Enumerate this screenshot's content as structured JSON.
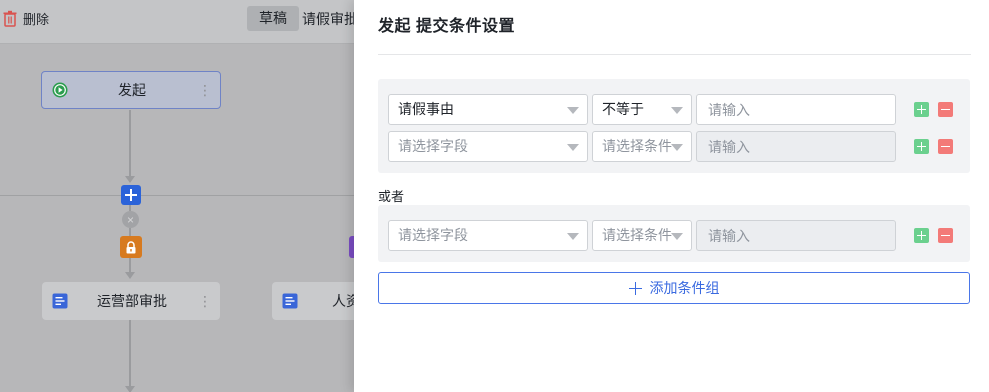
{
  "canvas": {
    "toolbar": {
      "delete_label": "删除",
      "draft_label": "草稿",
      "flow_title": "请假审批"
    },
    "nodes": {
      "start": {
        "label": "发起"
      },
      "operations": {
        "label": "运营部审批"
      },
      "hr": {
        "label": "人资"
      }
    }
  },
  "drawer": {
    "title": "发起 提交条件设置",
    "or_label": "或者",
    "add_group_label": "添加条件组",
    "groups": [
      {
        "rows": [
          {
            "field": "请假事由",
            "field_is_placeholder": false,
            "operator": "不等于",
            "operator_is_placeholder": false,
            "value_placeholder": "请输入",
            "value": "",
            "disabled": false
          },
          {
            "field": "请选择字段",
            "field_is_placeholder": true,
            "operator": "请选择条件",
            "operator_is_placeholder": true,
            "value_placeholder": "请输入",
            "value": "",
            "disabled": true
          }
        ]
      },
      {
        "rows": [
          {
            "field": "请选择字段",
            "field_is_placeholder": true,
            "operator": "请选择条件",
            "operator_is_placeholder": true,
            "value_placeholder": "请输入",
            "value": "",
            "disabled": true
          }
        ]
      }
    ]
  },
  "colors": {
    "accent": "#3a6ae0",
    "add_button": "#6bd08e",
    "remove_button": "#f37a78",
    "start_node": "#2b9d4e",
    "lock_node": "#d77a1f"
  }
}
